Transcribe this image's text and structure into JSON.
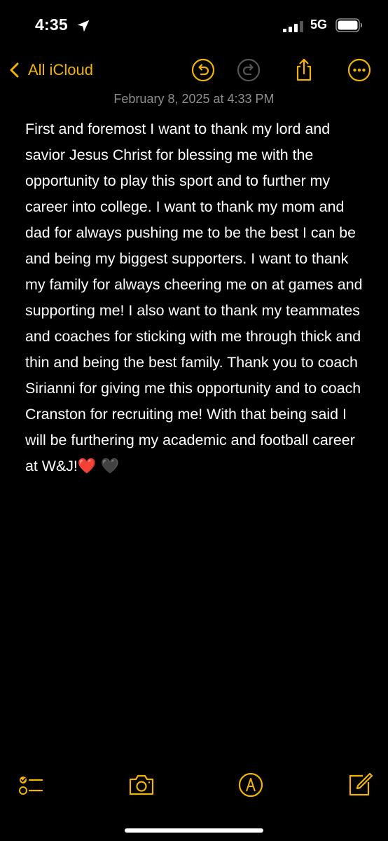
{
  "status_bar": {
    "time": "4:35",
    "network": "5G",
    "icons": [
      "location-arrow-icon",
      "cellular-signal-icon",
      "battery-icon"
    ]
  },
  "nav": {
    "back_label": "All iCloud",
    "icons": [
      "undo-icon",
      "redo-icon",
      "share-icon",
      "more-icon"
    ],
    "accent_color": "#f2b308"
  },
  "note": {
    "date": "February 8, 2025 at 4:33 PM",
    "body": "First and foremost I want to thank my lord and savior Jesus Christ for blessing me with the opportunity to play this sport and to further my career into college. I want to thank my mom and dad for always pushing me to be the best I can be and being my biggest supporters. I want to thank my family for always cheering me on at games and supporting me! I also want to thank my teammates and coaches for sticking with me through thick and thin and being the best family. Thank you to coach Sirianni for giving me this opportunity and to coach Cranston for recruiting me! With that being said I will be furthering my academic and football career at W&J!",
    "emoji_1": "❤️",
    "emoji_2": "🖤"
  },
  "toolbar": {
    "icons": [
      "checklist-icon",
      "camera-icon",
      "markup-pen-icon",
      "compose-icon"
    ]
  }
}
